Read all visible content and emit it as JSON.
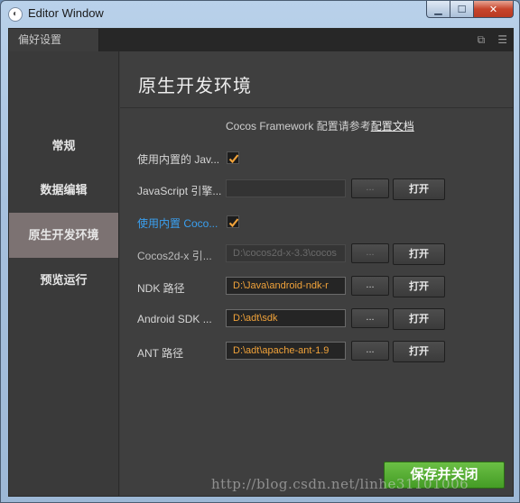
{
  "window": {
    "title": "Editor Window",
    "icons": {
      "app": "cocos-logo-icon",
      "minimize": "minimize-icon",
      "maximize": "maximize-icon",
      "close": "close-icon"
    }
  },
  "tab": {
    "label": "偏好设置",
    "tools": [
      "popout-icon",
      "menu-icon"
    ]
  },
  "sidebar": {
    "items": [
      {
        "label": "常规",
        "active": false
      },
      {
        "label": "数据编辑",
        "active": false
      },
      {
        "label": "原生开发环境",
        "active": true
      },
      {
        "label": "预览运行",
        "active": false
      }
    ]
  },
  "main": {
    "title": "原生开发环境",
    "doc_prefix": "Cocos Framework 配置请参考",
    "doc_link": "配置文档",
    "rows": {
      "builtin_js": {
        "label": "使用内置的 Jav...",
        "checked": true
      },
      "js_engine": {
        "label": "JavaScript 引擎...",
        "value": "",
        "dots": "...",
        "open": "打开"
      },
      "builtin_cocos": {
        "label": "使用内置 Coco...",
        "checked": true
      },
      "cocos2dx": {
        "label": "Cocos2d-x 引...",
        "value": "D:\\cocos2d-x-3.3\\cocos",
        "dots": "...",
        "open": "打开"
      },
      "ndk": {
        "label": "NDK 路径",
        "value": "D:\\Java\\android-ndk-r",
        "dots": "...",
        "open": "打开"
      },
      "android_sdk": {
        "label": "Android SDK ...",
        "value": "D:\\adt\\sdk",
        "dots": "...",
        "open": "打开"
      },
      "ant": {
        "label": "ANT 路径",
        "value": "D:\\adt\\apache-ant-1.9",
        "dots": "...",
        "open": "打开"
      }
    },
    "save_label": "保存并关闭"
  },
  "watermark": "http://blog.csdn.net/linhe31101006",
  "colors": {
    "accent_orange": "#f0a23a",
    "link_blue": "#3aa0f0",
    "save_green": "#4ea62c",
    "active_nav": "#7c7272"
  }
}
